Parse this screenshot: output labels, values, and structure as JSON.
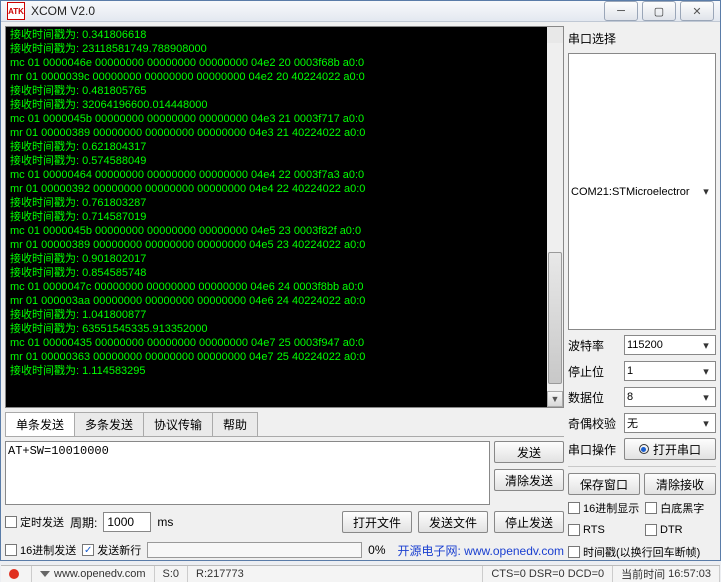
{
  "window": {
    "title": "XCOM V2.0",
    "logo": "ATK"
  },
  "terminal_lines": [
    "接收时间戳为: 0.341806618",
    "接收时间戳为: 23118581749.788908000",
    "mc 01 0000046e 00000000 00000000 00000000 04e2 20 0003f68b a0:0",
    "mr 01 0000039c 00000000 00000000 00000000 04e2 20 40224022 a0:0",
    "接收时间戳为: 0.481805765",
    "接收时间戳为: 32064196600.014448000",
    "mc 01 0000045b 00000000 00000000 00000000 04e3 21 0003f717 a0:0",
    "mr 01 00000389 00000000 00000000 00000000 04e3 21 40224022 a0:0",
    "接收时间戳为: 0.621804317",
    "接收时间戳为: 0.574588049",
    "mc 01 00000464 00000000 00000000 00000000 04e4 22 0003f7a3 a0:0",
    "mr 01 00000392 00000000 00000000 00000000 04e4 22 40224022 a0:0",
    "接收时间戳为: 0.761803287",
    "接收时间戳为: 0.714587019",
    "mc 01 0000045b 00000000 00000000 00000000 04e5 23 0003f82f a0:0",
    "mr 01 00000389 00000000 00000000 00000000 04e5 23 40224022 a0:0",
    "接收时间戳为: 0.901802017",
    "接收时间戳为: 0.854585748",
    "mc 01 0000047c 00000000 00000000 00000000 04e6 24 0003f8bb a0:0",
    "mr 01 000003aa 00000000 00000000 00000000 04e6 24 40224022 a0:0",
    "接收时间戳为: 1.041800877",
    "接收时间戳为: 63551545335.913352000",
    "mc 01 00000435 00000000 00000000 00000000 04e7 25 0003f947 a0:0",
    "mr 01 00000363 00000000 00000000 00000000 04e7 25 40224022 a0:0",
    "接收时间戳为: 1.114583295"
  ],
  "serial": {
    "section_title": "串口选择",
    "port": "COM21:STMicroelectror",
    "baud_label": "波特率",
    "baud": "115200",
    "stop_label": "停止位",
    "stop": "1",
    "data_label": "数据位",
    "data": "8",
    "parity_label": "奇偶校验",
    "parity": "无",
    "op_label": "串口操作",
    "op_button": "打开串口",
    "save_window": "保存窗口",
    "clear_recv": "清除接收",
    "hex_display": "16进制显示",
    "white_bg": "白底黑字",
    "rts": "RTS",
    "dtr": "DTR",
    "timestamp": "时间戳(以换行回车断帧)"
  },
  "send": {
    "tabs": [
      "单条发送",
      "多条发送",
      "协议传输",
      "帮助"
    ],
    "text": "AT+SW=10010000",
    "send_btn": "发送",
    "clear_send": "清除发送",
    "timed_send": "定时发送",
    "period_label": "周期:",
    "period": "1000",
    "period_unit": "ms",
    "open_file": "打开文件",
    "send_file": "发送文件",
    "stop_send": "停止发送",
    "hex_send": "16进制发送",
    "send_newline": "发送新行",
    "progress_pct": "0%",
    "link_label": "开源电子网:",
    "link_url": "www.openedv.com"
  },
  "status": {
    "domain": "www.openedv.com",
    "s": "S:0",
    "r": "R:217773",
    "lines": "CTS=0 DSR=0 DCD=0",
    "time_label": "当前时间",
    "time": "16:57:03"
  }
}
